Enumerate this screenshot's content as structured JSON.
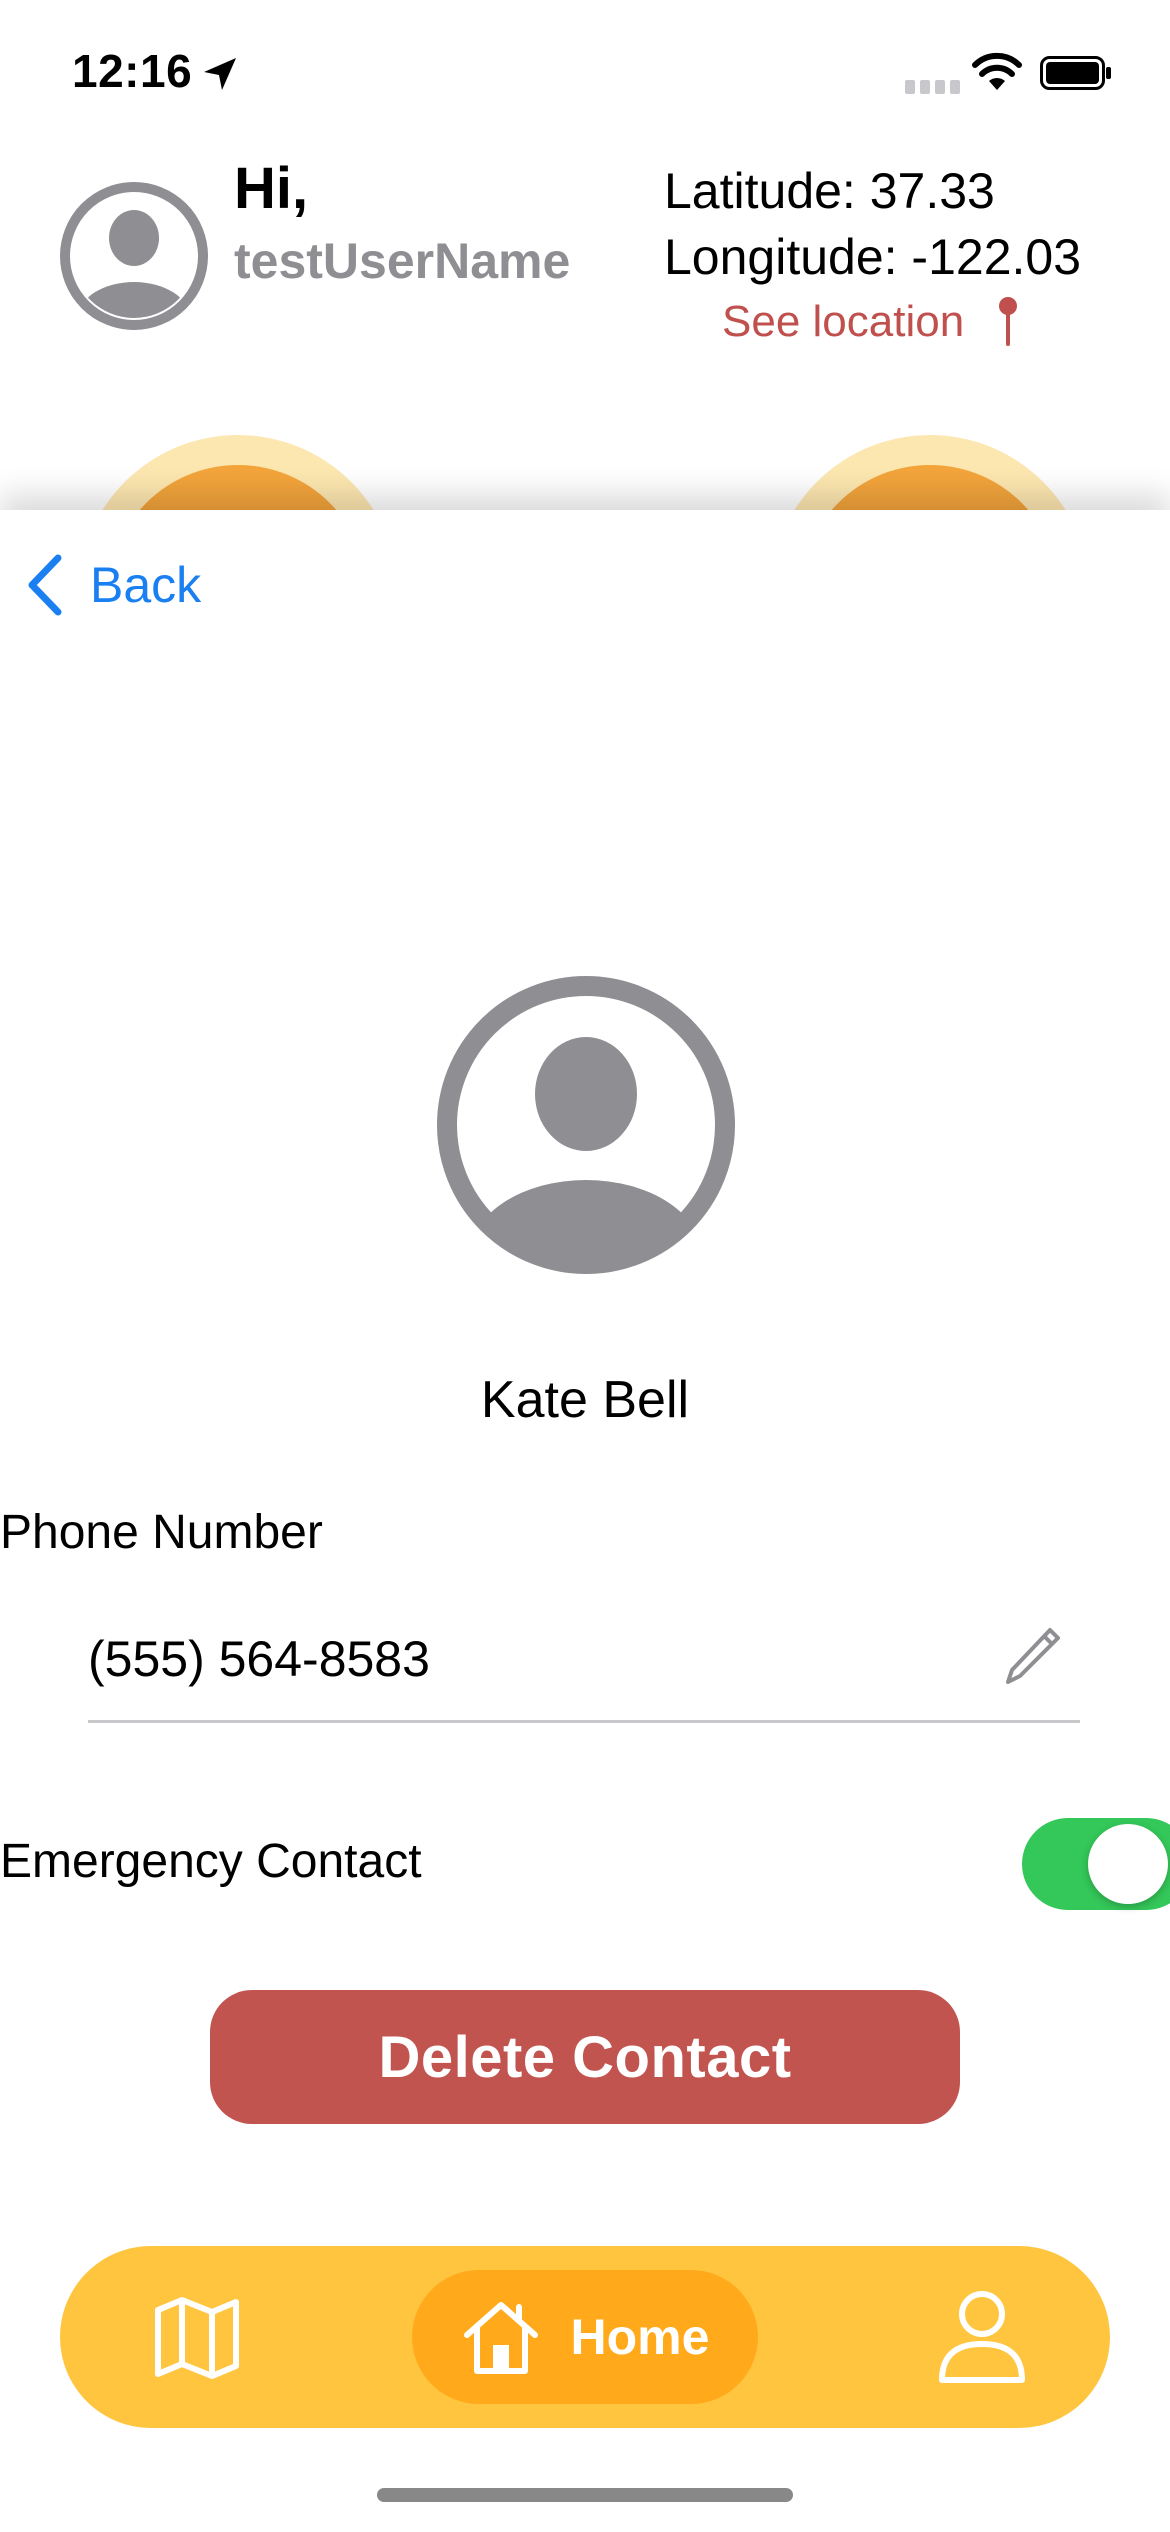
{
  "status_bar": {
    "time": "12:16"
  },
  "header": {
    "greeting": "Hi,",
    "username": "testUserName",
    "latitude_line": "Latitude: 37.33",
    "longitude_line": "Longitude:  -122.03",
    "see_location": "See location"
  },
  "nav": {
    "back_label": "Back"
  },
  "contact": {
    "name": "Kate Bell",
    "phone_label": "Phone Number",
    "phone_value": "(555) 564-8583",
    "emergency_label": "Emergency Contact",
    "emergency_enabled": true,
    "delete_label": "Delete Contact"
  },
  "tab_bar": {
    "items": [
      {
        "icon": "map-icon",
        "label": "",
        "selected": false
      },
      {
        "icon": "home-icon",
        "label": "Home",
        "selected": true
      },
      {
        "icon": "person-icon",
        "label": "",
        "selected": false
      }
    ]
  },
  "colors": {
    "accent_blue": "#1a7ff0",
    "link_red": "#c0504d",
    "delete_red": "#c25450",
    "toggle_green": "#34c759",
    "tab_bar_yellow": "#ffc53f",
    "tab_selected_orange": "#ffa91b",
    "secondary_gray": "#8e8e93"
  }
}
